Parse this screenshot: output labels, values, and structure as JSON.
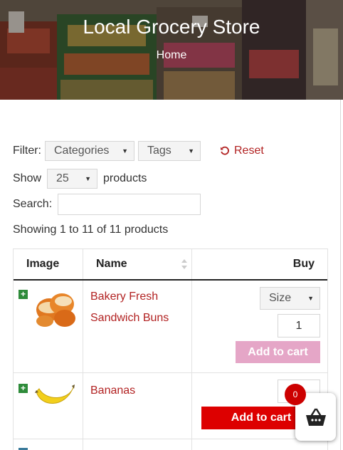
{
  "header": {
    "title": "Local Grocery Store",
    "breadcrumb": "Home"
  },
  "filters": {
    "label": "Filter:",
    "categories": "Categories",
    "tags": "Tags",
    "reset": "Reset"
  },
  "show": {
    "label": "Show",
    "value": "25",
    "suffix": "products"
  },
  "search": {
    "label": "Search:",
    "value": ""
  },
  "summary": "Showing 1 to 11 of 11 products",
  "table": {
    "headers": {
      "image": "Image",
      "name": "Name",
      "buy": "Buy"
    },
    "rows": [
      {
        "name_line1": "Bakery Fresh",
        "name_line2": "Sandwich Buns",
        "size": "Size",
        "qty": "1",
        "button": "Add to cart"
      },
      {
        "name_line1": "Bananas",
        "qty": "",
        "button": "Add to cart"
      }
    ]
  },
  "cart": {
    "count": "0"
  },
  "colors": {
    "accent": "#b22222",
    "button_red": "#dd0000",
    "button_pale": "#e5a6c7",
    "expand_green": "#2e8b3a"
  }
}
